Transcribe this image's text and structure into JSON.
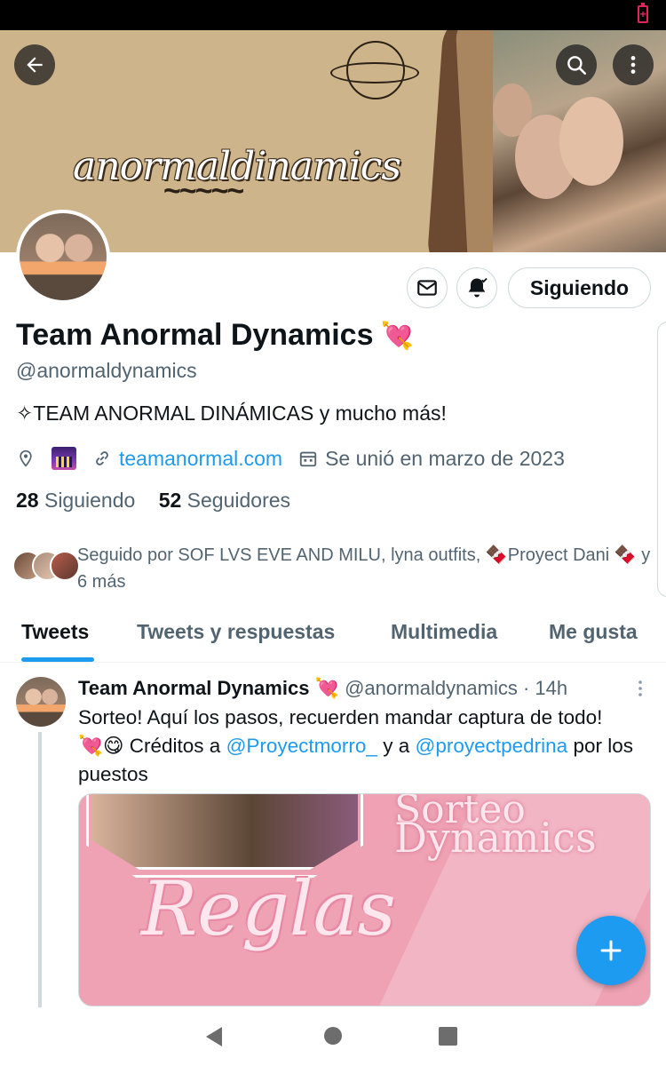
{
  "status_bar": {
    "battery_icon": "battery-charging-icon",
    "battery_symbol": "+",
    "battery_color": "#e0245e"
  },
  "header": {
    "banner_text": "anormaldinamics",
    "banner_squiggle": "~~~~~",
    "back_icon": "arrow-left-icon",
    "search_icon": "search-icon",
    "more_icon": "more-vertical-icon"
  },
  "profile": {
    "display_name": "Team Anormal Dynamics",
    "name_emoji": "💘",
    "handle": "@anormaldynamics",
    "bio": "✧TEAM ANORMAL DINÁMICAS  y mucho más!",
    "location_icon": "location-pin-icon",
    "location_emoji": "city-night-emoji",
    "link_icon": "link-icon",
    "website": "teamanormal.com",
    "calendar_icon": "calendar-icon",
    "joined": "Se unió en marzo de 2023",
    "following_count": "28",
    "following_label": "Siguiendo",
    "followers_count": "52",
    "followers_label": "Seguidores",
    "followed_by": "Seguido por SOF LVS EVE AND MILU, lyna outfits, 🍫Proyect Dani 🍫 y 6 más"
  },
  "actions": {
    "message_icon": "envelope-icon",
    "notifications_icon": "bell-check-icon",
    "follow_label": "Siguiendo"
  },
  "tabs": [
    {
      "label": "Tweets",
      "active": true
    },
    {
      "label": "Tweets y respuestas",
      "active": false
    },
    {
      "label": "Multimedia",
      "active": false
    },
    {
      "label": "Me gusta",
      "active": false
    }
  ],
  "tweet": {
    "author": "Team Anormal Dynamics",
    "author_emoji": "💘",
    "handle_time": "@anormaldynamics · 14h",
    "text_line1": "Sorteo! Aquí los pasos, recuerden mandar captura de todo!",
    "text_emojis": "💘😋",
    "text_creditos": "Créditos a",
    "mention1": "@Proyectmorro_",
    "text_y_a": "y a",
    "mention2": "@proyectpedrina",
    "text_end": "por los puestos",
    "media": {
      "title_line1": "Sorteo",
      "title_line2": "Dynamics",
      "label": "Reglas"
    }
  },
  "fab": {
    "icon": "plus-icon"
  },
  "colors": {
    "accent": "#1d9bf0",
    "text": "#0f1419",
    "secondary_text": "#536471",
    "border": "#cfd9de"
  },
  "system_nav": {
    "back": "nav-back-icon",
    "home": "nav-home-icon",
    "recents": "nav-recents-icon"
  }
}
